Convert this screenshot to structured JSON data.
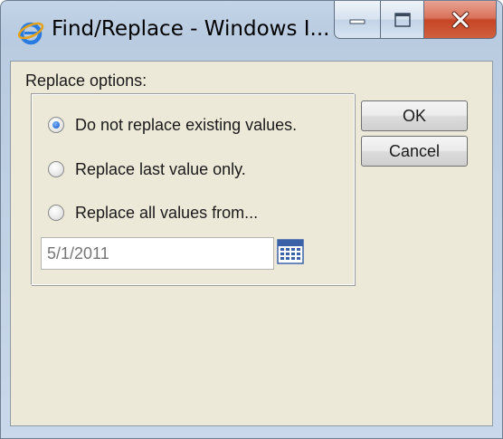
{
  "window": {
    "title": "Find/Replace - Windows I...",
    "controls": {
      "minimize": "minimize-icon",
      "maximize": "maximize-icon",
      "close": "close-icon"
    }
  },
  "form": {
    "legend": "Replace options:",
    "options": [
      {
        "label": "Do not replace existing values.",
        "checked": true
      },
      {
        "label": "Replace last value only.",
        "checked": false
      },
      {
        "label": "Replace all values from...",
        "checked": false
      }
    ],
    "date_field": {
      "placeholder": "5/1/2011",
      "icon": "calendar-icon"
    }
  },
  "buttons": {
    "ok": "OK",
    "cancel": "Cancel"
  },
  "colors": {
    "frame": "#c3d4e7",
    "client_bg": "#ece9d8",
    "close_red": "#c64525",
    "radio_selected": "#2d6fd6"
  }
}
